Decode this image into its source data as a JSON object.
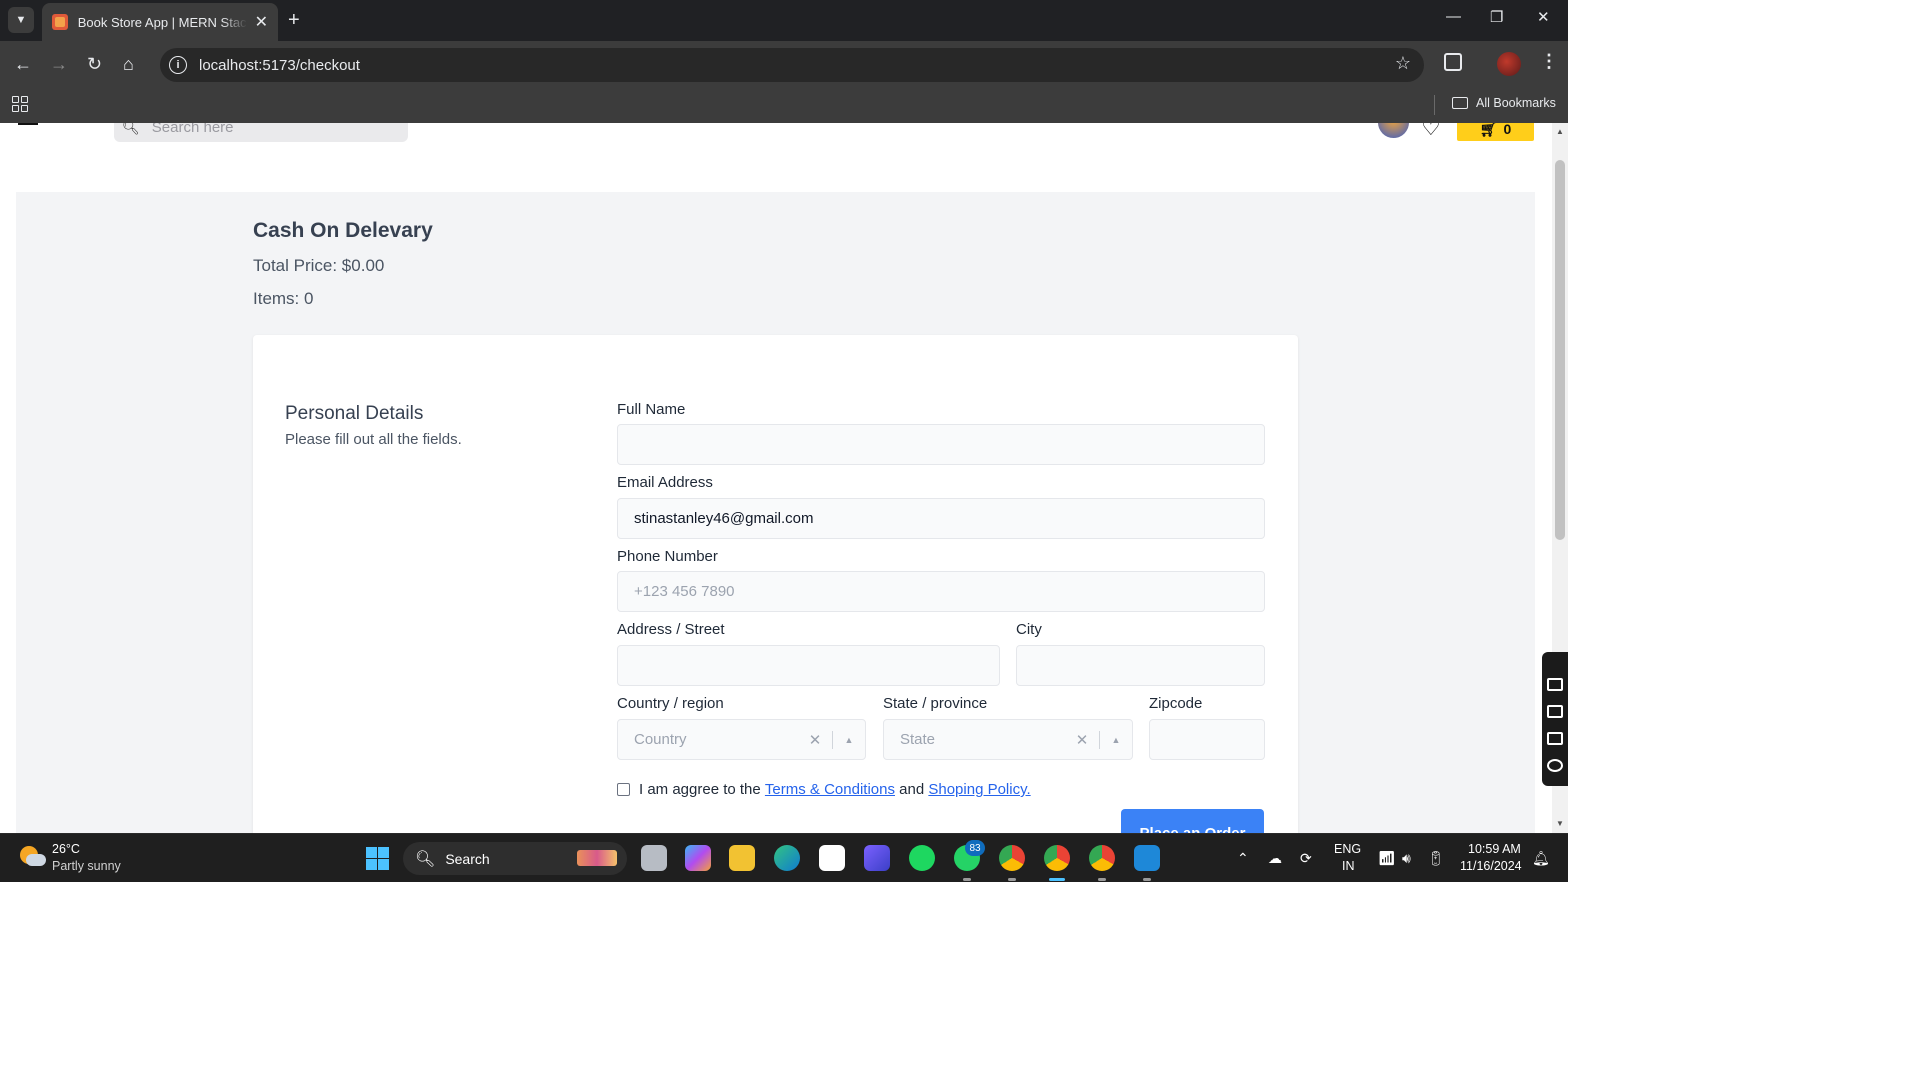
{
  "browser": {
    "tab_title": "Book Store App | MERN Stack Project",
    "url": "localhost:5173/checkout",
    "bookmarks_label": "All Bookmarks"
  },
  "site_header": {
    "search_placeholder": "Search here",
    "cart_count": "0"
  },
  "checkout": {
    "title": "Cash On Delevary",
    "total_price": "Total Price: $0.00",
    "items": "Items: 0",
    "section_title": "Personal Details",
    "section_subtitle": "Please fill out all the fields.",
    "fields": {
      "full_name_label": "Full Name",
      "full_name_value": "",
      "email_label": "Email Address",
      "email_value": "stinastanley46@gmail.com",
      "phone_label": "Phone Number",
      "phone_placeholder": "+123 456 7890",
      "address_label": "Address / Street",
      "city_label": "City",
      "country_label": "Country / region",
      "country_placeholder": "Country",
      "state_label": "State / province",
      "state_placeholder": "State",
      "zipcode_label": "Zipcode"
    },
    "agree": {
      "prefix": "I am aggree to the",
      "terms_link": "Terms & Conditions",
      "middle": "and",
      "policy_link": "Shoping Policy."
    },
    "submit_label": "Place an Order"
  },
  "taskbar": {
    "temperature": "26°C",
    "weather": "Partly sunny",
    "search_label": "Search",
    "whatsapp_badge": "83",
    "language": "ENG",
    "region": "IN",
    "time": "10:59 AM",
    "date": "11/16/2024"
  },
  "colors": {
    "accent_button": "#3b82f6",
    "cart_button": "#ffce1a",
    "link": "#2563eb",
    "page_background": "#f3f4f6"
  }
}
